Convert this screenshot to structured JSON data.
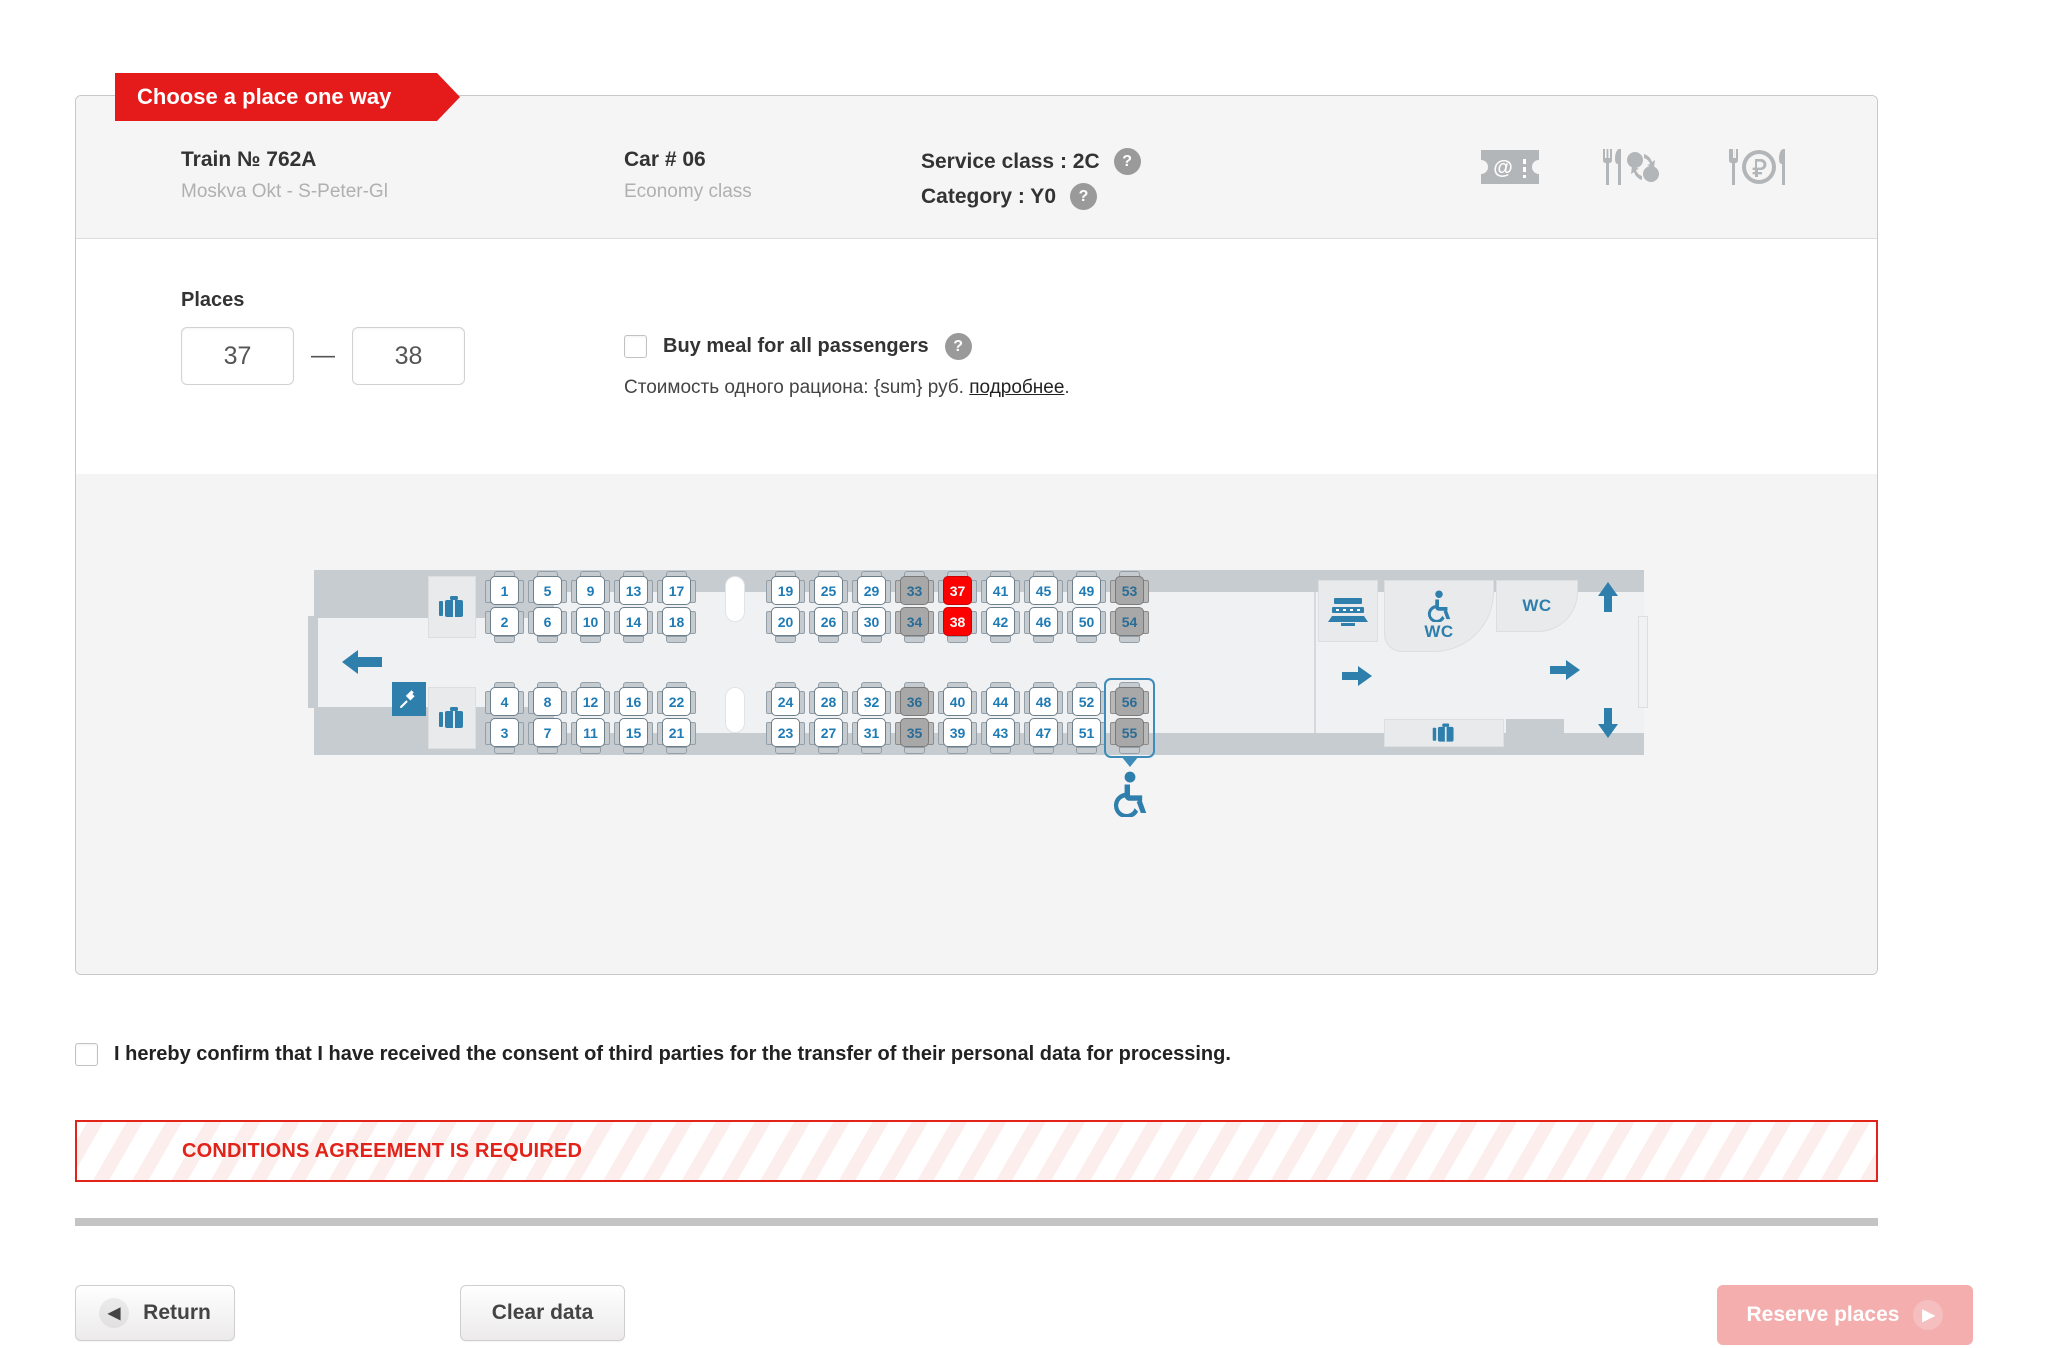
{
  "ribbon": {
    "label": "Choose a place one way"
  },
  "header": {
    "train": {
      "title": "Train №  762A",
      "route": "Moskva Okt - S-Peter-Gl"
    },
    "car": {
      "title": "Car # 06",
      "subtitle": "Economy class"
    },
    "service_class": {
      "label": "Service class : 2C",
      "help": "?"
    },
    "category": {
      "label": "Category : Y0",
      "help": "?"
    },
    "icons": [
      {
        "name": "e-ticket-icon",
        "title": "Electronic ticket"
      },
      {
        "name": "meal-exchange-icon",
        "title": "Meal can be changed"
      },
      {
        "name": "meal-paid-icon",
        "title": "Meal for a fee"
      }
    ]
  },
  "places": {
    "label": "Places",
    "from": "37",
    "to": "38",
    "separator": "—"
  },
  "meal": {
    "checkbox_label": "Buy meal for all passengers",
    "help": "?",
    "note_before": "Стоимость одного рациона: {sum} руб. ",
    "note_link": "подробнее",
    "note_after": "."
  },
  "seatmap": {
    "legend_colors": {
      "available": "#ffffff",
      "occupied": "#a8a8a8",
      "selected": "#ff0000",
      "accent": "#2f7fad"
    },
    "wc_label": "WC",
    "wc_accessible_label": "WC",
    "selected_seats": [
      "37",
      "38"
    ],
    "occupied_seats": [
      "33",
      "34",
      "35",
      "36",
      "53",
      "54",
      "55",
      "56"
    ],
    "accessible_seats": [
      "55",
      "56"
    ],
    "left_block": [
      {
        "top": [
          "1",
          "2"
        ],
        "bottom": [
          "4",
          "3"
        ]
      },
      {
        "top": [
          "5",
          "6"
        ],
        "bottom": [
          "8",
          "7"
        ]
      },
      {
        "top": [
          "9",
          "10"
        ],
        "bottom": [
          "12",
          "11"
        ]
      },
      {
        "top": [
          "13",
          "14"
        ],
        "bottom": [
          "16",
          "15"
        ]
      },
      {
        "top": [
          "17",
          "18"
        ],
        "bottom": [
          "22",
          "21"
        ]
      }
    ],
    "right_block": [
      {
        "top": [
          "19",
          "20"
        ],
        "bottom": [
          "24",
          "23"
        ]
      },
      {
        "top": [
          "25",
          "26"
        ],
        "bottom": [
          "28",
          "27"
        ]
      },
      {
        "top": [
          "29",
          "30"
        ],
        "bottom": [
          "32",
          "31"
        ]
      },
      {
        "top": [
          "33",
          "34"
        ],
        "bottom": [
          "36",
          "35"
        ]
      },
      {
        "top": [
          "37",
          "38"
        ],
        "bottom": [
          "40",
          "39"
        ]
      },
      {
        "top": [
          "41",
          "42"
        ],
        "bottom": [
          "44",
          "43"
        ]
      },
      {
        "top": [
          "45",
          "46"
        ],
        "bottom": [
          "48",
          "47"
        ]
      },
      {
        "top": [
          "49",
          "50"
        ],
        "bottom": [
          "52",
          "51"
        ]
      },
      {
        "top": [
          "53",
          "54"
        ],
        "bottom": [
          "56",
          "55"
        ]
      }
    ],
    "amenity_icons": [
      {
        "name": "luggage-icon"
      },
      {
        "name": "power-socket-icon"
      },
      {
        "name": "arrow-left-icon"
      },
      {
        "name": "arrow-right-icon"
      },
      {
        "name": "arrow-up-icon"
      },
      {
        "name": "arrow-down-icon"
      },
      {
        "name": "service-counter-icon"
      },
      {
        "name": "wheelchair-icon"
      }
    ]
  },
  "consent": {
    "text": "I hereby confirm that I have received the consent of third parties for the transfer of their personal data for processing."
  },
  "error": {
    "text": "CONDITIONS AGREEMENT IS REQUIRED"
  },
  "footer": {
    "return_label": "Return",
    "clear_label": "Clear data",
    "reserve_label": "Reserve places"
  }
}
